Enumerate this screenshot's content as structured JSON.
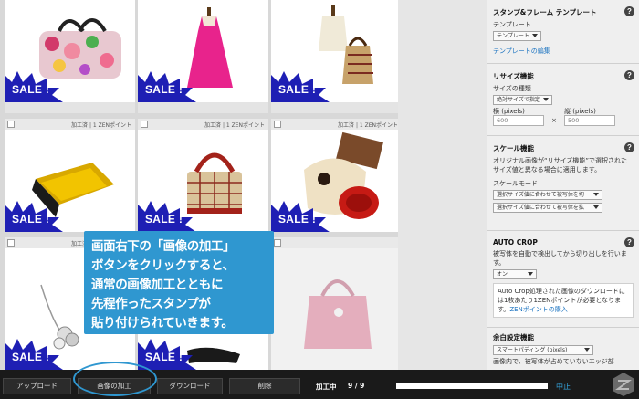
{
  "meta": {
    "status": "加工済",
    "points": "1 ZENポイント"
  },
  "sale_label": "SALE !",
  "callout": {
    "lines": [
      "画面右下の「画像の加工」",
      "ボタンをクリックすると、",
      "通常の画像加工とともに",
      "先程作ったスタンプが",
      "貼り付けられていきます。"
    ]
  },
  "sidebar": {
    "stamp": {
      "title": "スタンプ&フレーム テンプレート",
      "label": "テンプレート",
      "select": "テンプレート",
      "edit_link": "テンプレートの編集"
    },
    "resize": {
      "title": "リサイズ機能",
      "kind_label": "サイズの種類",
      "kind_value": "絶対サイズで指定",
      "width_label": "横 (pixels)",
      "height_label": "縦 (pixels)",
      "width": "600",
      "height": "500",
      "times": "×"
    },
    "scale": {
      "title": "スケール機能",
      "desc": "オリジナル画像が“リサイズ機能”で選択されたサイズ値と異なる場合に適用します。",
      "mode_label": "スケールモード",
      "opt1": "選択サイズ値に合わせて被写体を切",
      "opt2": "選択サイズ値に合わせて被写体を拡"
    },
    "autocrop": {
      "title": "AUTO CROP",
      "desc": "被写体を自動で検出してから切り出しを行います。",
      "select": "オン",
      "note": "Auto Crop処理された画像のダウンロードには1枚あたり1ZENポイントが必要となります。",
      "link": "ZENポイントの購入"
    },
    "margin": {
      "title": "余白設定機能",
      "select": "スマートパディング (pixels)",
      "desc": "画像内で、被写体が占めていないエッジ部"
    }
  },
  "toolbar": {
    "upload": "アップロード",
    "process": "画像の加工",
    "download": "ダウンロード",
    "delete": "削除",
    "processing": "加工中",
    "count": "9 / 9",
    "progress": 1.0,
    "stop": "中止"
  },
  "colors": {
    "sale": "#1e1fb4",
    "accent": "#2f97d0"
  }
}
